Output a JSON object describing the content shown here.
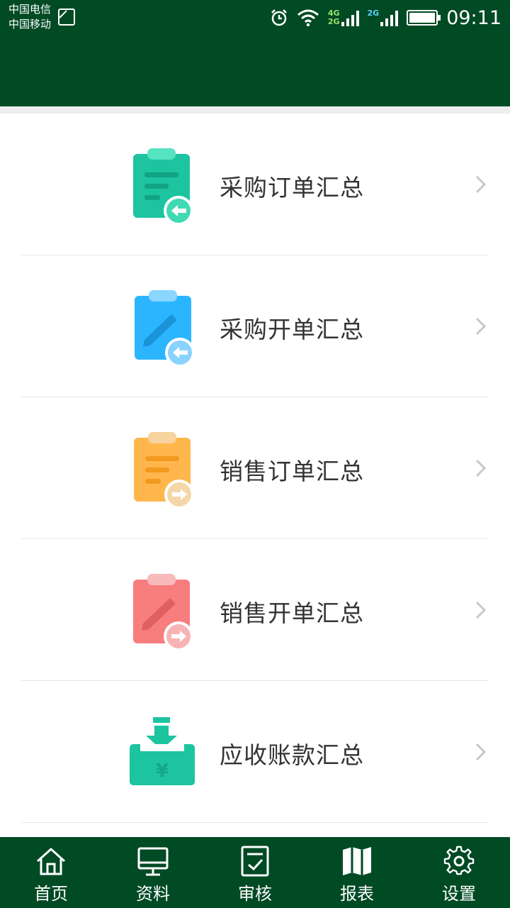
{
  "status_bar": {
    "carrier_1": "中国电信",
    "carrier_2": "中国移动",
    "net_1": "4G",
    "net_2": "2G",
    "net_3": "2G",
    "time": "09:11"
  },
  "menu": {
    "items": [
      {
        "label": "采购订单汇总",
        "icon": "purchase-order-clipboard-icon",
        "color": "#1dc4a0"
      },
      {
        "label": "采购开单汇总",
        "icon": "purchase-bill-clipboard-icon",
        "color": "#2bb5ff"
      },
      {
        "label": "销售订单汇总",
        "icon": "sales-order-clipboard-icon",
        "color": "#ffb74d"
      },
      {
        "label": "销售开单汇总",
        "icon": "sales-bill-clipboard-icon",
        "color": "#f87d7d"
      },
      {
        "label": "应收账款汇总",
        "icon": "receivables-tray-icon",
        "color": "#1dc4a0"
      }
    ]
  },
  "tabbar": {
    "tabs": [
      {
        "label": "首页",
        "icon": "home-icon"
      },
      {
        "label": "资料",
        "icon": "monitor-icon"
      },
      {
        "label": "审核",
        "icon": "checklist-icon"
      },
      {
        "label": "报表",
        "icon": "map-icon"
      },
      {
        "label": "设置",
        "icon": "gear-icon"
      }
    ]
  },
  "colors": {
    "primary_dark": "#004a24",
    "text": "#333333",
    "divider": "#e6e6e6"
  }
}
